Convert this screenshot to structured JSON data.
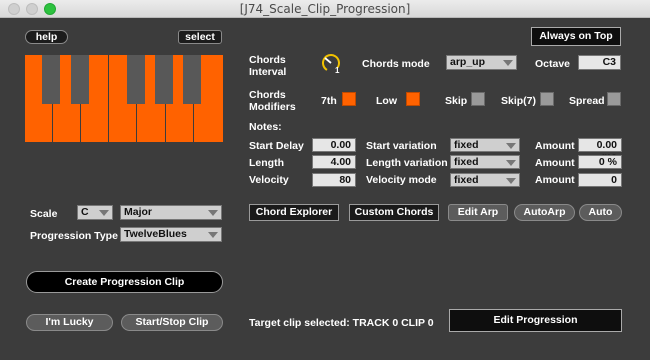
{
  "window": {
    "title": "[J74_Scale_Clip_Progression]"
  },
  "header": {
    "help_label": "help",
    "select_label": "select",
    "always_on_top_label": "Always on Top"
  },
  "chords": {
    "interval_label_line1": "Chords",
    "interval_label_line2": "Interval",
    "interval_knob_value": "1",
    "mode_label": "Chords mode",
    "mode_value": "arp_up",
    "octave_label": "Octave",
    "octave_value": "C3",
    "modifiers_label_line1": "Chords",
    "modifiers_label_line2": "Modifiers",
    "modifiers": [
      {
        "label": "7th",
        "on": true
      },
      {
        "label": "Low",
        "on": true
      },
      {
        "label": "Skip",
        "on": false
      },
      {
        "label": "Skip(7)",
        "on": false
      },
      {
        "label": "Spread",
        "on": false
      }
    ]
  },
  "notes": {
    "label": "Notes:",
    "start_delay_label": "Start Delay",
    "start_delay_value": "0.00",
    "length_label": "Length",
    "length_value": "4.00",
    "velocity_label": "Velocity",
    "velocity_value": "80",
    "start_variation_label": "Start variation",
    "start_variation_value": "fixed",
    "length_variation_label": "Length variation",
    "length_variation_value": "fixed",
    "velocity_mode_label": "Velocity mode",
    "velocity_mode_value": "fixed",
    "amount_label": "Amount",
    "amount1_value": "0.00 ms",
    "amount2_value": "0 %",
    "amount3_value": "0"
  },
  "scale": {
    "label": "Scale",
    "root_value": "C",
    "type_value": "Major",
    "progression_label": "Progression Type",
    "progression_value": "TwelveBlues"
  },
  "buttons": {
    "chord_explorer": "Chord Explorer",
    "custom_chords": "Custom Chords",
    "edit_arp": "Edit Arp",
    "autoarp": "AutoArp",
    "auto": "Auto",
    "create_progression_clip": "Create Progression Clip",
    "im_lucky": "I'm Lucky",
    "start_stop_clip": "Start/Stop Clip",
    "edit_progression": "Edit Progression"
  },
  "status": {
    "target_clip": "Target clip selected: TRACK 0 CLIP 0"
  },
  "colors": {
    "accent": "#ff6200",
    "panel": "#3c3c3c",
    "off_toggle": "#9a9a9a",
    "maximize": "#2dc23f"
  }
}
